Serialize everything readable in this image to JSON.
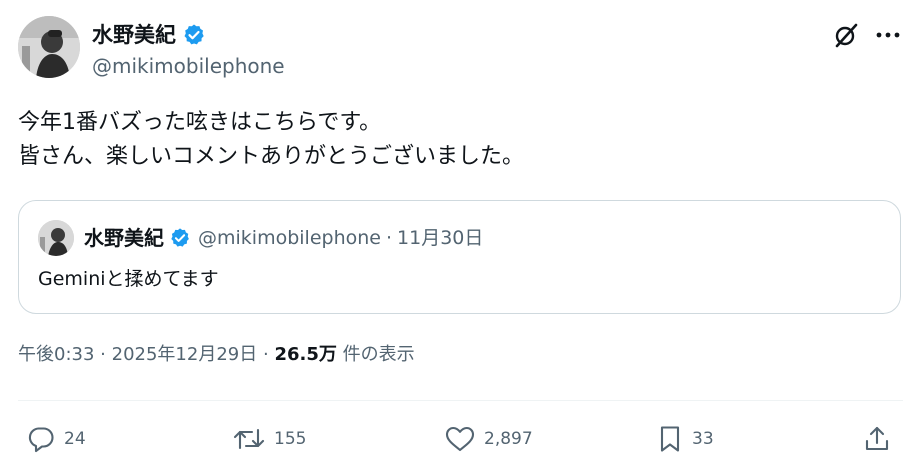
{
  "author": {
    "name": "水野美紀",
    "handle": "@mikimobilephone",
    "verified": true
  },
  "post": {
    "lines": [
      "今年1番バズった呟きはこちらです。",
      "皆さん、楽しいコメントありがとうございました。"
    ]
  },
  "quote": {
    "name": "水野美紀",
    "handle": "@mikimobilephone",
    "separator": "·",
    "date": "11月30日",
    "text": "Geminiと揉めてます"
  },
  "meta": {
    "time": "午後0:33",
    "sep1": "·",
    "date": "2025年12月29日",
    "sep2": "·",
    "views_count": "26.5万",
    "views_label": "件の表示"
  },
  "actions": {
    "replies": "24",
    "reposts": "155",
    "likes": "2,897",
    "bookmarks": "33"
  },
  "colors": {
    "verified": "#1d9bf0",
    "text": "#0f1419",
    "secondary": "#536471",
    "border": "#cfd9de"
  },
  "icons": [
    "grok-icon",
    "more-icon",
    "verified-badge-icon",
    "reply-icon",
    "repost-icon",
    "like-icon",
    "bookmark-icon",
    "share-icon"
  ]
}
